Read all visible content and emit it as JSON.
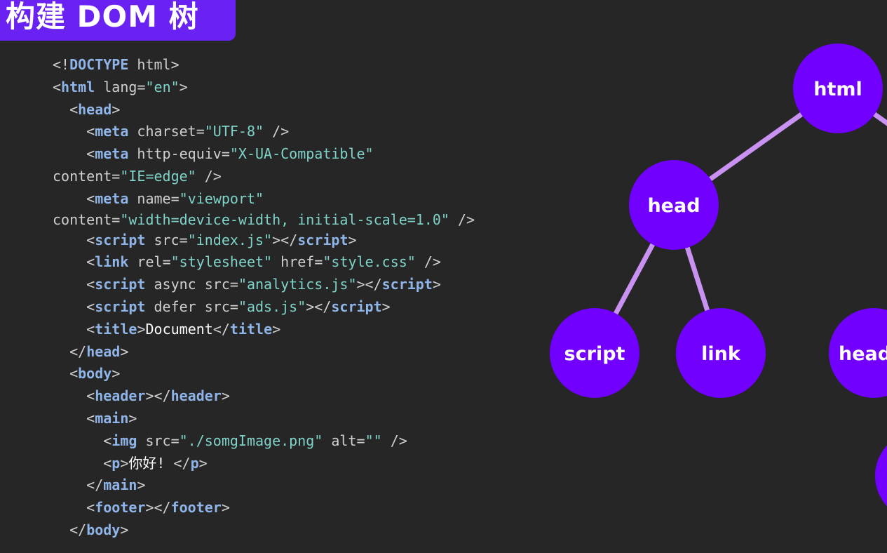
{
  "slide": {
    "title": "构建 DOM 树"
  },
  "code_lines": [
    [
      {
        "t": "<!",
        "c": "pun"
      },
      {
        "t": "DOCTYPE",
        "c": "kw"
      },
      {
        "t": " html>",
        "c": "attr"
      }
    ],
    [
      {
        "t": "<",
        "c": "pun"
      },
      {
        "t": "html",
        "c": "kw"
      },
      {
        "t": " lang",
        "c": "attr"
      },
      {
        "t": "=",
        "c": "pun"
      },
      {
        "t": "\"en\"",
        "c": "str"
      },
      {
        "t": ">",
        "c": "pun"
      }
    ],
    [
      {
        "t": "  <",
        "c": "pun"
      },
      {
        "t": "head",
        "c": "kw"
      },
      {
        "t": ">",
        "c": "pun"
      }
    ],
    [
      {
        "t": "    <",
        "c": "pun"
      },
      {
        "t": "meta",
        "c": "kw"
      },
      {
        "t": " charset",
        "c": "attr"
      },
      {
        "t": "=",
        "c": "pun"
      },
      {
        "t": "\"UTF-8\"",
        "c": "str"
      },
      {
        "t": " />",
        "c": "pun"
      }
    ],
    [
      {
        "t": "    <",
        "c": "pun"
      },
      {
        "t": "meta",
        "c": "kw"
      },
      {
        "t": " http-equiv",
        "c": "attr"
      },
      {
        "t": "=",
        "c": "pun"
      },
      {
        "t": "\"X-UA-Compatible\"",
        "c": "str"
      }
    ],
    [
      {
        "t": "content",
        "c": "attr"
      },
      {
        "t": "=",
        "c": "pun"
      },
      {
        "t": "\"IE=edge\"",
        "c": "str"
      },
      {
        "t": " />",
        "c": "pun"
      }
    ],
    [
      {
        "t": "    <",
        "c": "pun"
      },
      {
        "t": "meta",
        "c": "kw"
      },
      {
        "t": " name",
        "c": "attr"
      },
      {
        "t": "=",
        "c": "pun"
      },
      {
        "t": "\"viewport\"",
        "c": "str"
      }
    ],
    [
      {
        "t": "content",
        "c": "attr"
      },
      {
        "t": "=",
        "c": "pun"
      },
      {
        "t": "\"width=device-width, initial-scale=1.0\"",
        "c": "str"
      },
      {
        "t": " />",
        "c": "pun"
      }
    ],
    [
      {
        "t": "    <",
        "c": "pun"
      },
      {
        "t": "script",
        "c": "kw"
      },
      {
        "t": " src",
        "c": "attr"
      },
      {
        "t": "=",
        "c": "pun"
      },
      {
        "t": "\"index.js\"",
        "c": "str"
      },
      {
        "t": "></",
        "c": "pun"
      },
      {
        "t": "script",
        "c": "kw"
      },
      {
        "t": ">",
        "c": "pun"
      }
    ],
    [
      {
        "t": "    <",
        "c": "pun"
      },
      {
        "t": "link",
        "c": "kw"
      },
      {
        "t": " rel",
        "c": "attr"
      },
      {
        "t": "=",
        "c": "pun"
      },
      {
        "t": "\"stylesheet\"",
        "c": "str"
      },
      {
        "t": " href",
        "c": "attr"
      },
      {
        "t": "=",
        "c": "pun"
      },
      {
        "t": "\"style.css\"",
        "c": "str"
      },
      {
        "t": " />",
        "c": "pun"
      }
    ],
    [
      {
        "t": "    <",
        "c": "pun"
      },
      {
        "t": "script",
        "c": "kw"
      },
      {
        "t": " async src",
        "c": "attr"
      },
      {
        "t": "=",
        "c": "pun"
      },
      {
        "t": "\"analytics.js\"",
        "c": "str"
      },
      {
        "t": "></",
        "c": "pun"
      },
      {
        "t": "script",
        "c": "kw"
      },
      {
        "t": ">",
        "c": "pun"
      }
    ],
    [
      {
        "t": "    <",
        "c": "pun"
      },
      {
        "t": "script",
        "c": "kw"
      },
      {
        "t": " defer src",
        "c": "attr"
      },
      {
        "t": "=",
        "c": "pun"
      },
      {
        "t": "\"ads.js\"",
        "c": "str"
      },
      {
        "t": "></",
        "c": "pun"
      },
      {
        "t": "script",
        "c": "kw"
      },
      {
        "t": ">",
        "c": "pun"
      }
    ],
    [
      {
        "t": "    <",
        "c": "pun"
      },
      {
        "t": "title",
        "c": "kw"
      },
      {
        "t": ">",
        "c": "pun"
      },
      {
        "t": "Document",
        "c": "txt"
      },
      {
        "t": "</",
        "c": "pun"
      },
      {
        "t": "title",
        "c": "kw"
      },
      {
        "t": ">",
        "c": "pun"
      }
    ],
    [
      {
        "t": "  </",
        "c": "pun"
      },
      {
        "t": "head",
        "c": "kw"
      },
      {
        "t": ">",
        "c": "pun"
      }
    ],
    [
      {
        "t": "  <",
        "c": "pun"
      },
      {
        "t": "body",
        "c": "kw"
      },
      {
        "t": ">",
        "c": "pun"
      }
    ],
    [
      {
        "t": "    <",
        "c": "pun"
      },
      {
        "t": "header",
        "c": "kw"
      },
      {
        "t": "></",
        "c": "pun"
      },
      {
        "t": "header",
        "c": "kw"
      },
      {
        "t": ">",
        "c": "pun"
      }
    ],
    [
      {
        "t": "    <",
        "c": "pun"
      },
      {
        "t": "main",
        "c": "kw"
      },
      {
        "t": ">",
        "c": "pun"
      }
    ],
    [
      {
        "t": "      <",
        "c": "pun"
      },
      {
        "t": "img",
        "c": "kw"
      },
      {
        "t": " src",
        "c": "attr"
      },
      {
        "t": "=",
        "c": "pun"
      },
      {
        "t": "\"./somgImage.png\"",
        "c": "str"
      },
      {
        "t": " alt",
        "c": "attr"
      },
      {
        "t": "=",
        "c": "pun"
      },
      {
        "t": "\"\"",
        "c": "str"
      },
      {
        "t": " />",
        "c": "pun"
      }
    ],
    [
      {
        "t": "      <",
        "c": "pun"
      },
      {
        "t": "p",
        "c": "kw"
      },
      {
        "t": ">",
        "c": "pun"
      },
      {
        "t": "你好! ",
        "c": "txt"
      },
      {
        "t": "</",
        "c": "pun"
      },
      {
        "t": "p",
        "c": "kw"
      },
      {
        "t": ">",
        "c": "pun"
      }
    ],
    [
      {
        "t": "    </",
        "c": "pun"
      },
      {
        "t": "main",
        "c": "kw"
      },
      {
        "t": ">",
        "c": "pun"
      }
    ],
    [
      {
        "t": "    <",
        "c": "pun"
      },
      {
        "t": "footer",
        "c": "kw"
      },
      {
        "t": "></",
        "c": "pun"
      },
      {
        "t": "footer",
        "c": "kw"
      },
      {
        "t": ">",
        "c": "pun"
      }
    ],
    [
      {
        "t": "  </",
        "c": "pun"
      },
      {
        "t": "body",
        "c": "kw"
      },
      {
        "t": ">",
        "c": "pun"
      }
    ]
  ],
  "tree": {
    "nodes": [
      {
        "id": "html",
        "label": "html"
      },
      {
        "id": "head",
        "label": "head"
      },
      {
        "id": "script",
        "label": "script"
      },
      {
        "id": "link",
        "label": "link"
      },
      {
        "id": "header",
        "label": "head"
      },
      {
        "id": "clipped",
        "label": ""
      }
    ],
    "edges": [
      {
        "from": "html",
        "to": "head"
      },
      {
        "from": "html",
        "to": "offscreen"
      },
      {
        "from": "head",
        "to": "script"
      },
      {
        "from": "head",
        "to": "link"
      }
    ]
  },
  "colors": {
    "banner": "#6a22f2",
    "node": "#7100ff",
    "edge": "#c891f2",
    "keyword": "#8fb4e8",
    "string": "#7fd3c8"
  }
}
